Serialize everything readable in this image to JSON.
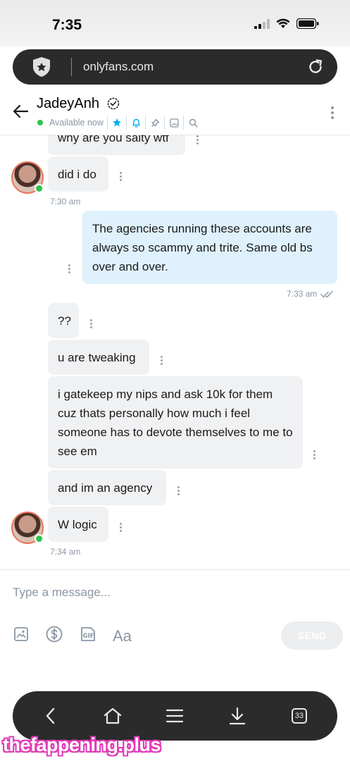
{
  "status_bar": {
    "time": "7:35"
  },
  "browser": {
    "url": "onlyfans.com"
  },
  "chat_header": {
    "name": "JadeyAnh",
    "status": "Available now"
  },
  "messages": [
    {
      "id": "m1",
      "direction": "in",
      "text": "why are you salty wtf"
    },
    {
      "id": "m2",
      "direction": "in",
      "text": "did i do",
      "time": "7:30 am"
    },
    {
      "id": "m3",
      "direction": "out",
      "text": "The agencies running these accounts are always so scammy and trite. Same old bs over and over.",
      "time": "7:33 am"
    },
    {
      "id": "m4",
      "direction": "in",
      "text": "??"
    },
    {
      "id": "m5",
      "direction": "in",
      "text": "u are tweaking"
    },
    {
      "id": "m6",
      "direction": "in",
      "text": "i gatekeep my nips and ask 10k for them cuz thats personally how much i feel someone has to devote themselves to me to see em"
    },
    {
      "id": "m7",
      "direction": "in",
      "text": "and im an agency"
    },
    {
      "id": "m8",
      "direction": "in",
      "text": "W logic",
      "time": "7:34 am"
    }
  ],
  "composer": {
    "placeholder": "Type a message...",
    "send_label": "SEND",
    "aa_label": "Aa"
  },
  "bottom_nav": {
    "tabs_count": "33"
  },
  "watermark": "thefappening.plus",
  "colors": {
    "accent": "#00aff0",
    "online": "#2ec24d",
    "outgoing_bubble": "#dff1fc",
    "incoming_bubble": "#f0f1f3",
    "muted_text": "#8a96a3"
  }
}
